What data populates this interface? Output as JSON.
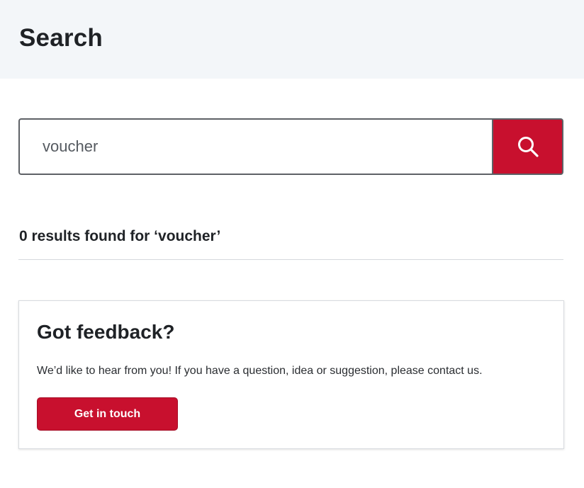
{
  "header": {
    "title": "Search"
  },
  "search": {
    "value": "voucher",
    "button_icon": "search-icon"
  },
  "results": {
    "summary": "0 results found for ‘voucher’"
  },
  "feedback": {
    "title": "Got feedback?",
    "text": "We’d like to hear from you! If you have a question, idea or suggestion, please contact us.",
    "button_label": "Get in touch"
  },
  "colors": {
    "accent": "#c8102e",
    "header_bg": "#f3f6f9",
    "text_dark": "#1f2226"
  }
}
